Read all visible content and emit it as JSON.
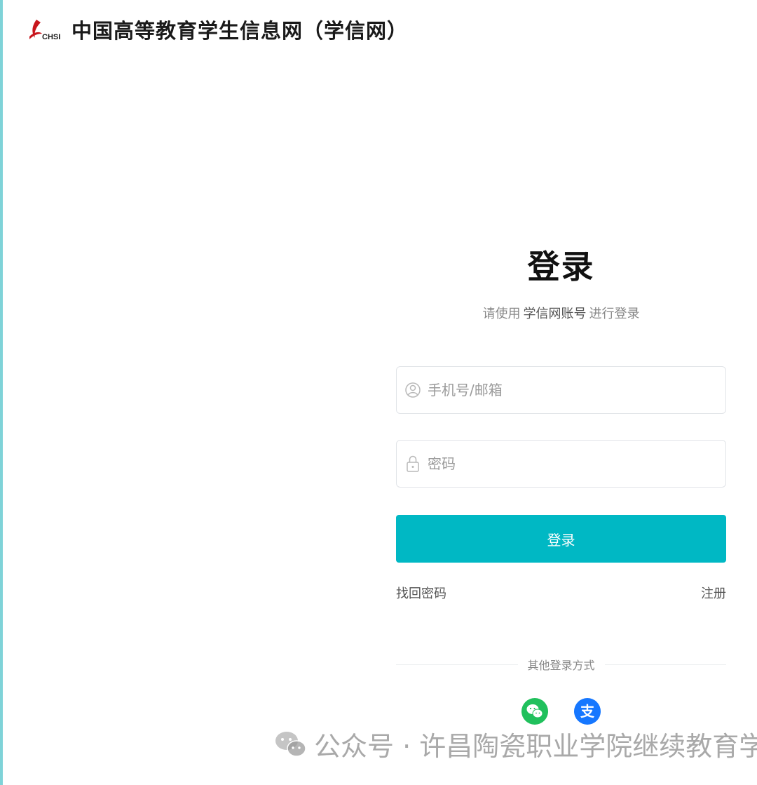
{
  "header": {
    "logo_text": "CHSI",
    "site_title": "中国高等教育学生信息网（学信网）"
  },
  "login": {
    "heading": "登录",
    "subtitle_prefix": "请使用",
    "subtitle_emphasis": "学信网账号",
    "subtitle_suffix": "进行登录",
    "phone_placeholder": "手机号/邮箱",
    "password_placeholder": "密码",
    "submit_label": "登录",
    "forgot_password": "找回密码",
    "register": "注册",
    "other_methods": "其他登录方式"
  },
  "sso": {
    "wechat_color": "#20c05c",
    "alipay_color": "#1677ff",
    "alipay_glyph": "支"
  },
  "watermark": {
    "text": "公众号 · 许昌陶瓷职业学院继续教育学院"
  },
  "colors": {
    "accent": "#00b8c4",
    "left_edge": "#7fd3d8"
  }
}
